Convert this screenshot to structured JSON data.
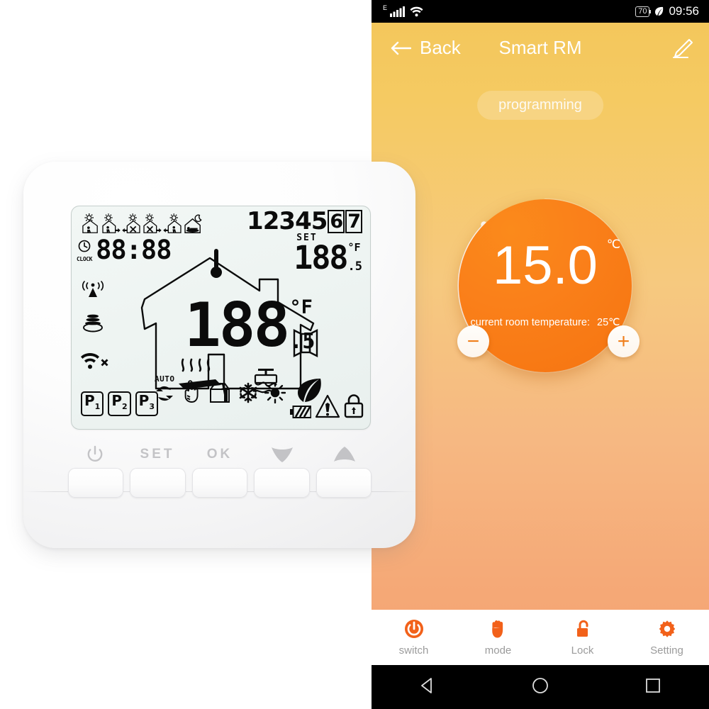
{
  "phone": {
    "statusbar": {
      "network_type": "E",
      "signal_icon": "cellular-signal-icon",
      "wifi_icon": "wifi-icon",
      "battery_level": "70",
      "leaf_icon": "power-saving-leaf-icon",
      "time": "09:56"
    },
    "appbar": {
      "back_icon": "arrow-left-icon",
      "back_label": "Back",
      "title": "Smart RM",
      "edit_icon": "pencil-edit-icon"
    },
    "programming_button": "programming",
    "dial": {
      "target_temperature": "15.0",
      "unit": "℃",
      "current_room_label": "current room temperature:",
      "current_room_value": "25℃",
      "minus_label": "−",
      "plus_label": "+",
      "accent_color": "#F8801A",
      "arc_color": "#FFFFFF"
    },
    "toolbar": [
      {
        "icon": "power-icon",
        "label": "switch"
      },
      {
        "icon": "hand-icon",
        "label": "mode"
      },
      {
        "icon": "unlock-icon",
        "label": "Lock"
      },
      {
        "icon": "gear-icon",
        "label": "Setting"
      }
    ],
    "navbar": [
      {
        "icon": "android-back-icon"
      },
      {
        "icon": "android-home-icon"
      },
      {
        "icon": "android-recents-icon"
      }
    ]
  },
  "thermostat": {
    "lcd": {
      "schedule_icons": [
        "period-1-wake-home-icon",
        "period-2-leave-icon",
        "period-3-return-icon",
        "period-4-leave-icon",
        "period-5-return-icon",
        "period-6-sleep-icon"
      ],
      "days": [
        "1",
        "2",
        "3",
        "4",
        "5",
        "6",
        "7"
      ],
      "days_boxed": [
        "6",
        "7"
      ],
      "clock_icon": "clock-icon",
      "clock_label": "CLOCK",
      "clock_value": "88:88",
      "signal_icon": "rf-antenna-icon",
      "server_icon": "server-stack-icon",
      "wifi_off_icon": "wifi-disconnected-icon",
      "room_temp_value": "188",
      "room_temp_decimal": ".5",
      "room_temp_unit": "°F",
      "set_label": "SET",
      "set_value": "188",
      "set_decimal": ".5",
      "set_unit": "°F",
      "thermometer_icon": "thermometer-icon",
      "floor_heating_icon": "floor-heating-icon",
      "fan_icon": "fan-icon",
      "window_icon": "open-window-icon",
      "auto_label": "AUTO",
      "mode_icons": [
        "auto-cycle-icon",
        "manual-hand-icon",
        "holiday-bag-icon",
        "cooling-snowflake-icon",
        "heating-sun-icon",
        "eco-leaf-icon"
      ],
      "program_boxes": [
        {
          "letter": "P",
          "index": "1"
        },
        {
          "letter": "P",
          "index": "2"
        },
        {
          "letter": "P",
          "index": "3"
        }
      ],
      "battery_icon": "lcd-battery-icon",
      "warning_icon": "warning-triangle-icon",
      "lock_icon": "lock-icon"
    },
    "buttons": [
      {
        "icon": "power-icon",
        "label": ""
      },
      {
        "icon": "set-icon",
        "label": "SET"
      },
      {
        "icon": "ok-icon",
        "label": "OK"
      },
      {
        "icon": "down-arrow-icon",
        "label": ""
      },
      {
        "icon": "up-arrow-icon",
        "label": ""
      }
    ]
  }
}
